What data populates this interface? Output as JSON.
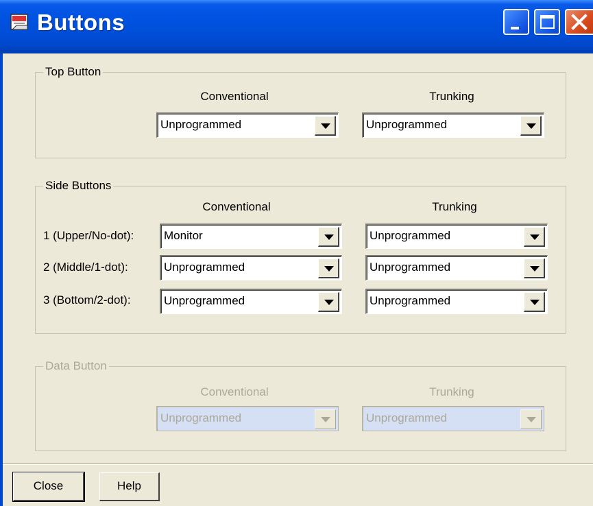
{
  "window": {
    "title": "Buttons",
    "icon": "doc-app-icon"
  },
  "top_button": {
    "label": "Top Button",
    "col_conventional": "Conventional",
    "col_trunking": "Trunking",
    "conventional_value": "Unprogrammed",
    "trunking_value": "Unprogrammed"
  },
  "side_buttons": {
    "label": "Side Buttons",
    "col_conventional": "Conventional",
    "col_trunking": "Trunking",
    "rows": [
      {
        "label": "1 (Upper/No-dot):",
        "conventional": "Monitor",
        "trunking": "Unprogrammed"
      },
      {
        "label": "2 (Middle/1-dot):",
        "conventional": "Unprogrammed",
        "trunking": "Unprogrammed"
      },
      {
        "label": "3 (Bottom/2-dot):",
        "conventional": "Unprogrammed",
        "trunking": "Unprogrammed"
      }
    ]
  },
  "data_button": {
    "label": "Data Button",
    "col_conventional": "Conventional",
    "col_trunking": "Trunking",
    "conventional_value": "Unprogrammed",
    "trunking_value": "Unprogrammed",
    "enabled": false
  },
  "footer": {
    "close_label": "Close",
    "help_label": "Help"
  }
}
